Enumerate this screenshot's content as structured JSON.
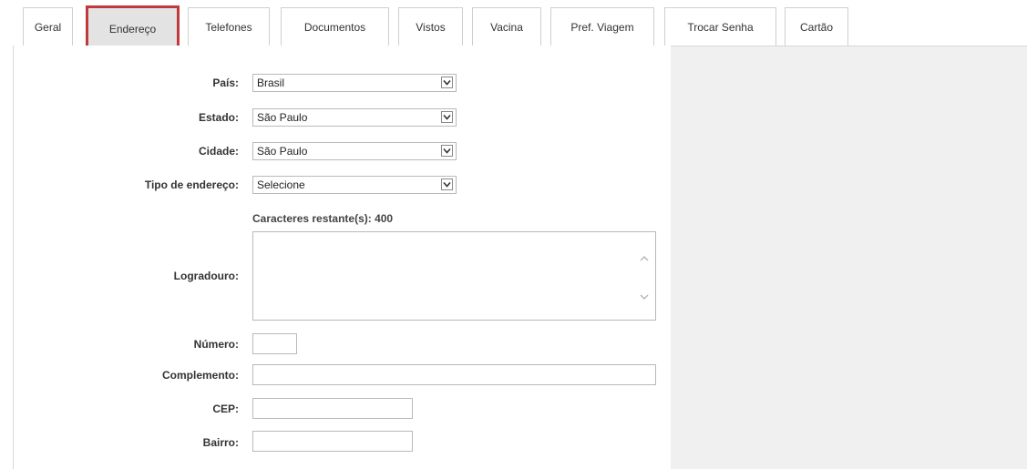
{
  "tabs": [
    {
      "label": "Geral"
    },
    {
      "label": "Endereço"
    },
    {
      "label": "Telefones"
    },
    {
      "label": "Documentos"
    },
    {
      "label": "Vistos"
    },
    {
      "label": "Vacina"
    },
    {
      "label": "Pref. Viagem"
    },
    {
      "label": "Trocar Senha"
    },
    {
      "label": "Cartão"
    }
  ],
  "active_tab": "Endereço",
  "form": {
    "pais": {
      "label": "País:",
      "value": "Brasil"
    },
    "estado": {
      "label": "Estado:",
      "value": "São Paulo"
    },
    "cidade": {
      "label": "Cidade:",
      "value": "São Paulo"
    },
    "tipo_endereco": {
      "label": "Tipo de endereço:",
      "value": "Selecione"
    },
    "counter": "Caracteres restante(s): 400",
    "logradouro": {
      "label": "Logradouro:",
      "value": ""
    },
    "numero": {
      "label": "Número:",
      "value": ""
    },
    "complemento": {
      "label": "Complemento:",
      "value": ""
    },
    "cep": {
      "label": "CEP:",
      "value": ""
    },
    "bairro": {
      "label": "Bairro:",
      "value": ""
    }
  },
  "colors": {
    "active_tab_border": "#c0393b",
    "active_tab_bg": "#e3e3e3",
    "side_bg": "#f0f0f0"
  },
  "icons": [
    "chevron-down-icon",
    "scroll-up-icon",
    "scroll-down-icon"
  ]
}
